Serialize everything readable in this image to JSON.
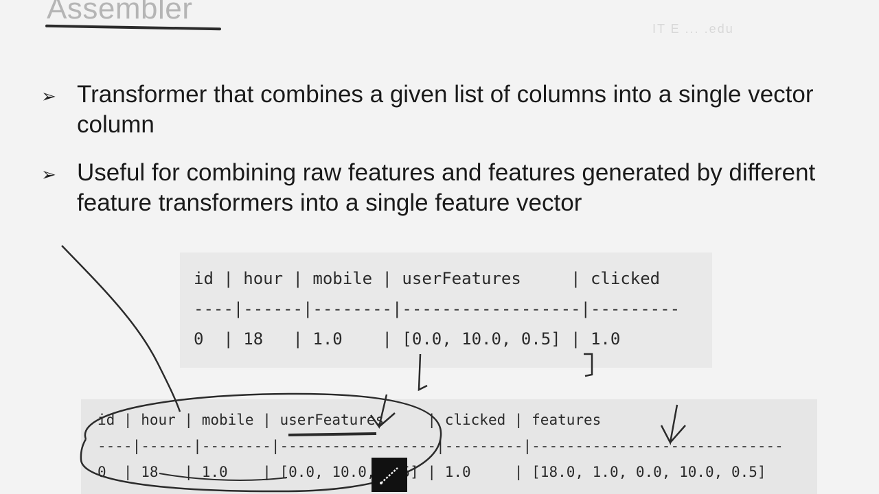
{
  "slide": {
    "title": "Assembler",
    "watermark": "IT E ... .edu",
    "bullets": [
      "Transformer that combines a given list of columns into a single vector column",
      "Useful for combining raw features and features generated by different feature transformers into a single feature vector"
    ],
    "bullet_marker": "➢"
  },
  "table_before": {
    "header": "id | hour | mobile | userFeatures     | clicked",
    "separator": "----|------|--------|------------------|---------",
    "row": "0  | 18   | 1.0    | [0.0, 10.0, 0.5] | 1.0"
  },
  "table_after": {
    "header": "id | hour | mobile | userFeatures     | clicked | features",
    "separator": "----|------|--------|------------------|---------|-----------------------------",
    "row": "0  | 18   | 1.0    | [0.0, 10.0, 0.5] | 1.0     | [18.0, 1.0, 0.0, 10.0, 0.5]"
  },
  "colors": {
    "background": "#f3f3f3",
    "title": "#b5b5b5",
    "ink": "#2b2b2b",
    "code_bg": "#e9e9e9"
  },
  "icons": [
    "pen-tool-icon"
  ]
}
